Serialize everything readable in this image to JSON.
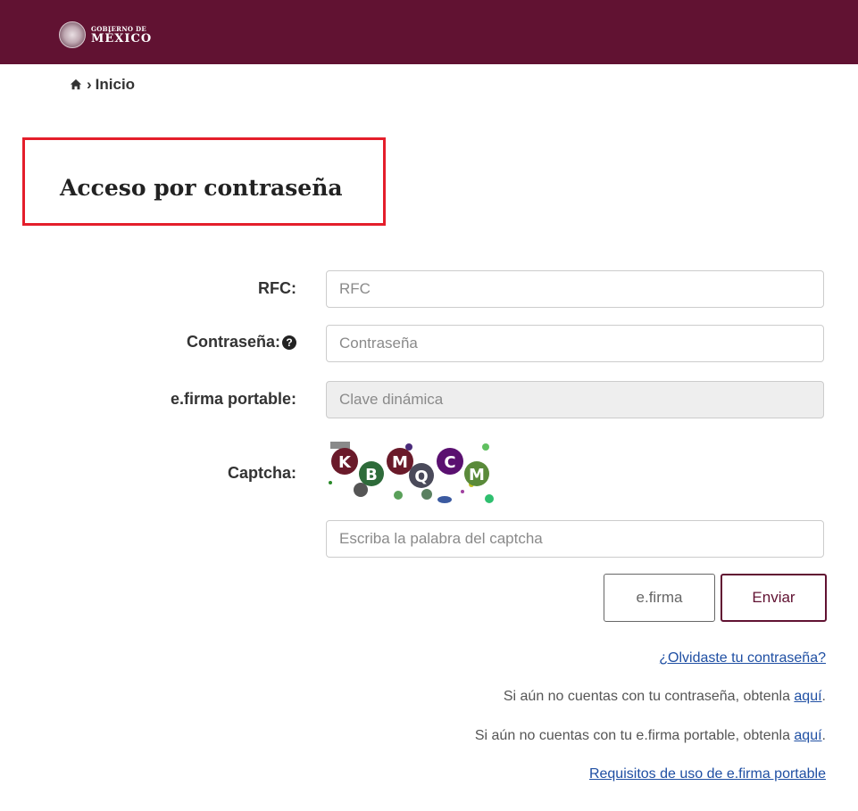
{
  "header": {
    "logo_small": "GOBIERNO DE",
    "logo_big": "MÉXICO",
    "bg_color": "#611232"
  },
  "breadcrumb": {
    "home_icon": "home-icon",
    "separator": "›",
    "current": "Inicio"
  },
  "page": {
    "title": "Acceso por contraseña",
    "highlight_color": "#e41e2b"
  },
  "form": {
    "rfc": {
      "label": "RFC:",
      "placeholder": "RFC",
      "value": ""
    },
    "password": {
      "label": "Contraseña:",
      "placeholder": "Contraseña",
      "value": "",
      "help_icon": "question-circle-icon"
    },
    "efirma_portable": {
      "label": "e.firma portable:",
      "placeholder": "Clave dinámica",
      "value": ""
    },
    "captcha": {
      "label": "Captcha:",
      "text": "KBMQCM",
      "placeholder": "Escriba la palabra del captcha",
      "value": ""
    }
  },
  "buttons": {
    "efirma": "e.firma",
    "enviar": "Enviar"
  },
  "links": {
    "forgot": "¿Olvidaste tu contraseña?",
    "no_password_text": "Si aún no cuentas con tu contraseña, obtenla ",
    "no_password_link": "aquí",
    "no_efirma_text": "Si aún no cuentas con tu e.firma portable, obtenla ",
    "no_efirma_link": "aquí",
    "period": ".",
    "requirements": "Requisitos de uso de e.firma portable"
  },
  "colors": {
    "accent": "#611232",
    "link": "#1f4fa3"
  }
}
